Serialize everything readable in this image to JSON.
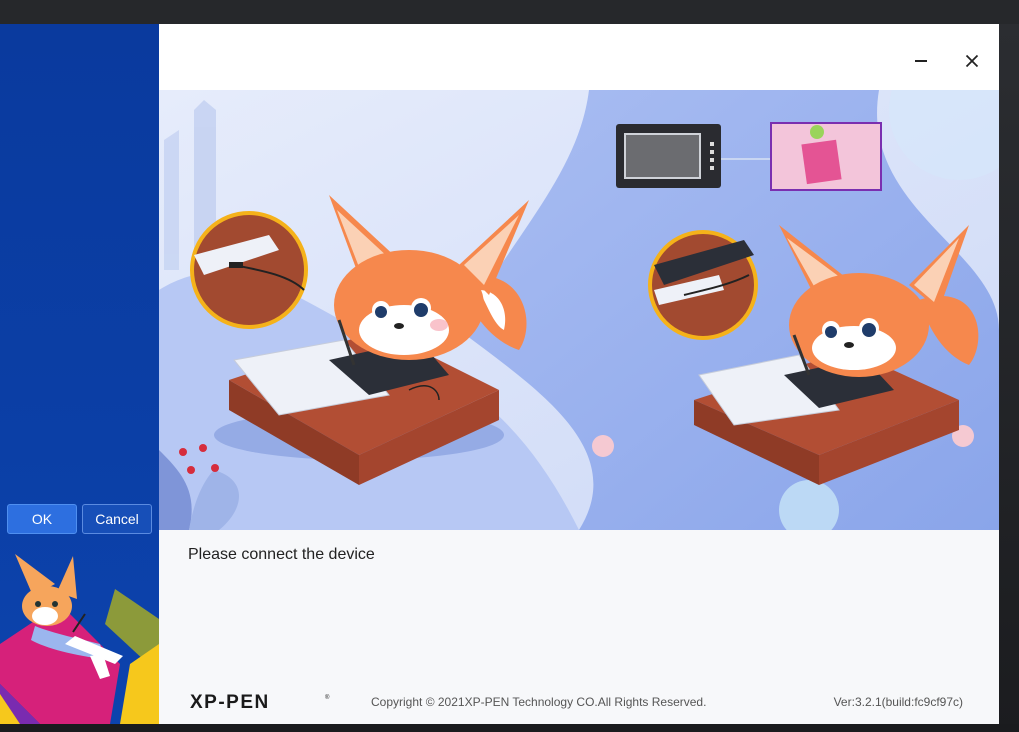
{
  "window": {
    "minimize_icon": "minimize-icon",
    "close_icon": "close-icon"
  },
  "dialog": {
    "ok_label": "OK",
    "cancel_label": "Cancel",
    "message": "Please connect the device"
  },
  "footer": {
    "logo_text": "XP-PEN",
    "copyright": "Copyright © 2021XP-PEN Technology CO.All Rights Reserved.",
    "version": "Ver:3.2.1(build:fc9cf97c)"
  },
  "colors": {
    "sidebar_blue": "#0b3fa6",
    "button_blue": "#2d6fe0",
    "banner_bg": "#dce6fb",
    "fox_orange": "#f6884d",
    "highlight_ring": "#f5b21a"
  }
}
